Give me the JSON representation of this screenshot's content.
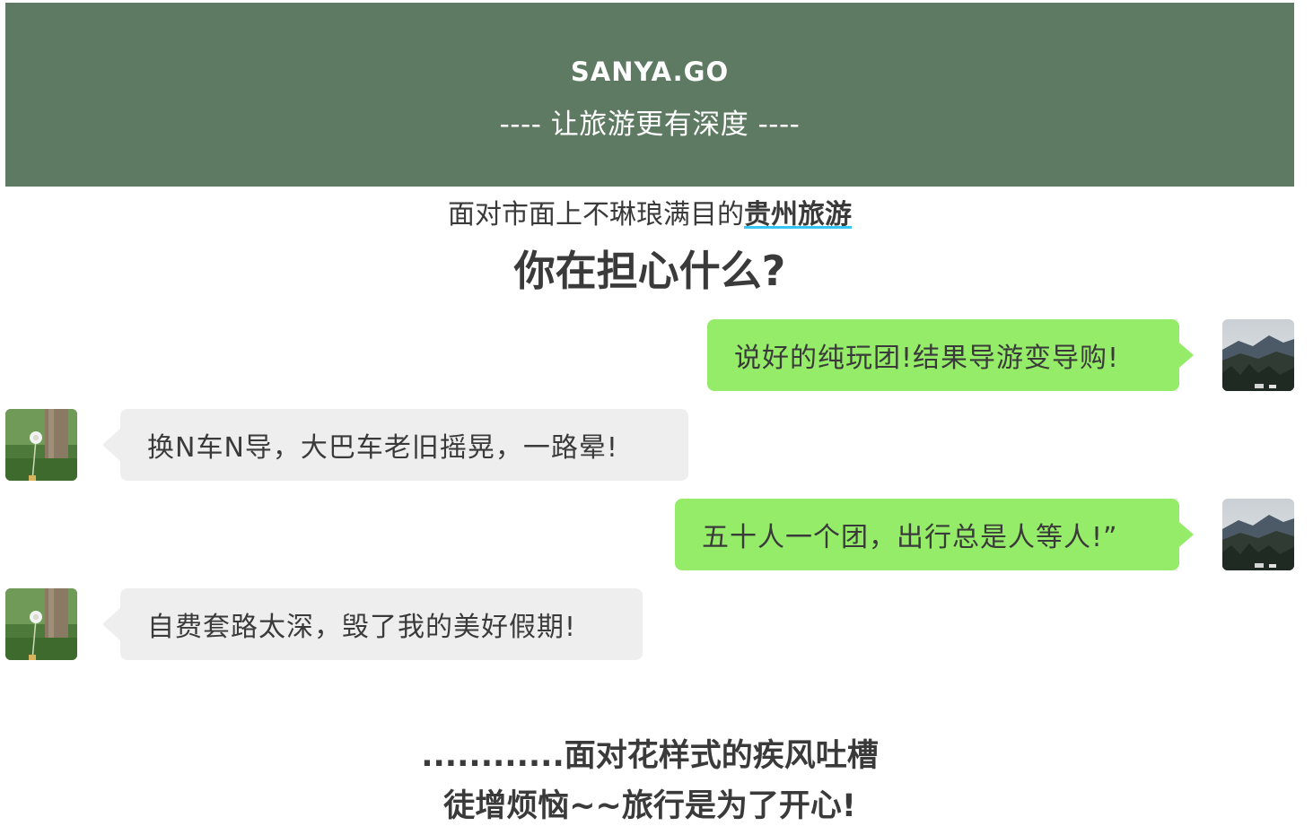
{
  "banner": {
    "brand": "SANYA.GO",
    "slogan": "---- 让旅游更有深度 ----",
    "background": "#5f7a62"
  },
  "intro": {
    "prefix": "面对市面上不琳琅满目的",
    "highlight": "贵州旅游",
    "highlight_underline_color": "#36c6f4"
  },
  "question": "你在担心什么?",
  "chat": [
    {
      "side": "right",
      "text": "说好的纯玩团!结果导游变导购!"
    },
    {
      "side": "left",
      "text": "换N车N导，大巴车老旧摇晃，一路晕!"
    },
    {
      "side": "right",
      "text": "五十人一个团，出行总是人等人!”"
    },
    {
      "side": "left",
      "text": "自费套路太深，毁了我的美好假期!"
    }
  ],
  "bubble_colors": {
    "right": "#95ec69",
    "left": "#eeeeee"
  },
  "closing": {
    "line1": "............面对花样式的疾风吐槽",
    "line2": "徒增烦恼~~旅行是为了开心!"
  }
}
